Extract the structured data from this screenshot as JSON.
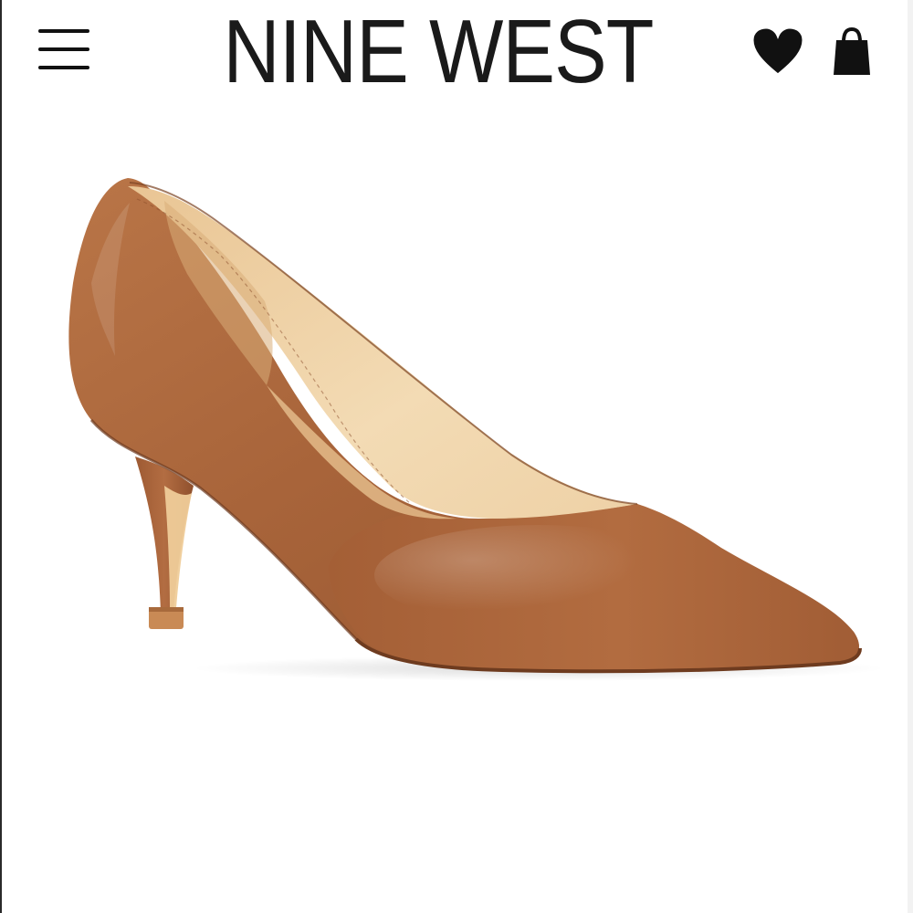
{
  "header": {
    "brand": "NINE WEST",
    "menu_icon": "hamburger-menu-icon",
    "wishlist_icon": "heart-icon",
    "bag_icon": "shopping-bag-icon"
  },
  "product": {
    "image": "brown-leather-pointed-toe-pump",
    "colors": {
      "leather": "#a8643a",
      "lining": "#f0d3a8",
      "heel_tip": "#c98a55"
    }
  },
  "theme": {
    "background": "#ffffff",
    "icon_color": "#111111",
    "logo_color": "#1a1a1a"
  }
}
